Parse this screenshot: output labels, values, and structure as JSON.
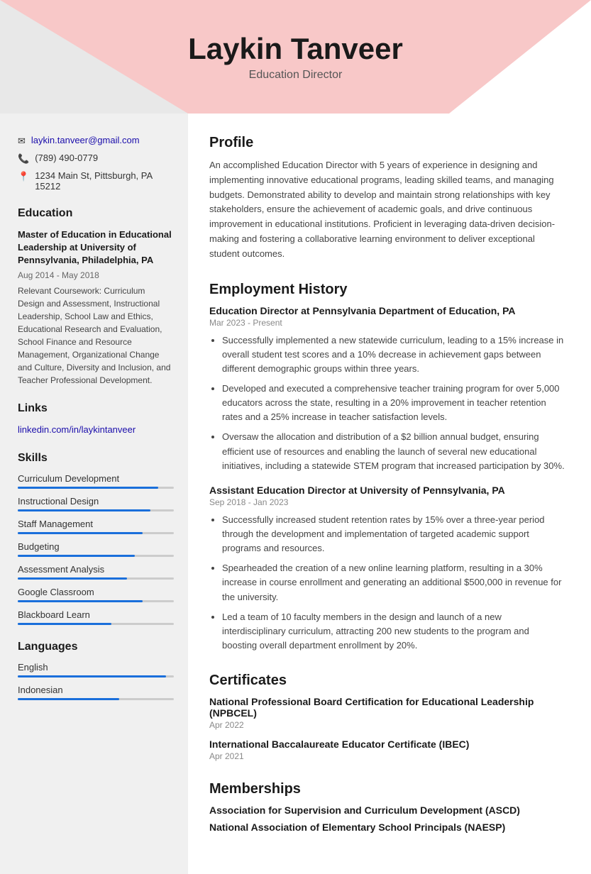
{
  "header": {
    "name": "Laykin Tanveer",
    "title": "Education Director"
  },
  "contact": {
    "email": "laykin.tanveer@gmail.com",
    "phone": "(789) 490-0779",
    "address": "1234 Main St, Pittsburgh, PA 15212"
  },
  "education": {
    "section_title": "Education",
    "degree": "Master of Education in Educational Leadership at University of Pennsylvania, Philadelphia, PA",
    "dates": "Aug 2014 - May 2018",
    "coursework_label": "Relevant Coursework:",
    "coursework": "Curriculum Design and Assessment, Instructional Leadership, School Law and Ethics, Educational Research and Evaluation, School Finance and Resource Management, Organizational Change and Culture, Diversity and Inclusion, and Teacher Professional Development."
  },
  "links": {
    "section_title": "Links",
    "linkedin": "linkedin.com/in/laykintanveer"
  },
  "skills": {
    "section_title": "Skills",
    "items": [
      {
        "name": "Curriculum Development",
        "width": "90%"
      },
      {
        "name": "Instructional Design",
        "width": "85%"
      },
      {
        "name": "Staff Management",
        "width": "80%"
      },
      {
        "name": "Budgeting",
        "width": "75%"
      },
      {
        "name": "Assessment Analysis",
        "width": "70%"
      },
      {
        "name": "Google Classroom",
        "width": "80%"
      },
      {
        "name": "Blackboard Learn",
        "width": "60%"
      }
    ]
  },
  "languages": {
    "section_title": "Languages",
    "items": [
      {
        "name": "English",
        "width": "95%"
      },
      {
        "name": "Indonesian",
        "width": "65%"
      }
    ]
  },
  "profile": {
    "section_title": "Profile",
    "text": "An accomplished Education Director with 5 years of experience in designing and implementing innovative educational programs, leading skilled teams, and managing budgets. Demonstrated ability to develop and maintain strong relationships with key stakeholders, ensure the achievement of academic goals, and drive continuous improvement in educational institutions. Proficient in leveraging data-driven decision-making and fostering a collaborative learning environment to deliver exceptional student outcomes."
  },
  "employment": {
    "section_title": "Employment History",
    "jobs": [
      {
        "title": "Education Director at Pennsylvania Department of Education, PA",
        "dates": "Mar 2023 - Present",
        "bullets": [
          "Successfully implemented a new statewide curriculum, leading to a 15% increase in overall student test scores and a 10% decrease in achievement gaps between different demographic groups within three years.",
          "Developed and executed a comprehensive teacher training program for over 5,000 educators across the state, resulting in a 20% improvement in teacher retention rates and a 25% increase in teacher satisfaction levels.",
          "Oversaw the allocation and distribution of a $2 billion annual budget, ensuring efficient use of resources and enabling the launch of several new educational initiatives, including a statewide STEM program that increased participation by 30%."
        ]
      },
      {
        "title": "Assistant Education Director at University of Pennsylvania, PA",
        "dates": "Sep 2018 - Jan 2023",
        "bullets": [
          "Successfully increased student retention rates by 15% over a three-year period through the development and implementation of targeted academic support programs and resources.",
          "Spearheaded the creation of a new online learning platform, resulting in a 30% increase in course enrollment and generating an additional $500,000 in revenue for the university.",
          "Led a team of 10 faculty members in the design and launch of a new interdisciplinary curriculum, attracting 200 new students to the program and boosting overall department enrollment by 20%."
        ]
      }
    ]
  },
  "certificates": {
    "section_title": "Certificates",
    "items": [
      {
        "title": "National Professional Board Certification for Educational Leadership (NPBCEL)",
        "date": "Apr 2022"
      },
      {
        "title": "International Baccalaureate Educator Certificate (IBEC)",
        "date": "Apr 2021"
      }
    ]
  },
  "memberships": {
    "section_title": "Memberships",
    "items": [
      "Association for Supervision and Curriculum Development (ASCD)",
      "National Association of Elementary School Principals (NAESP)"
    ]
  }
}
